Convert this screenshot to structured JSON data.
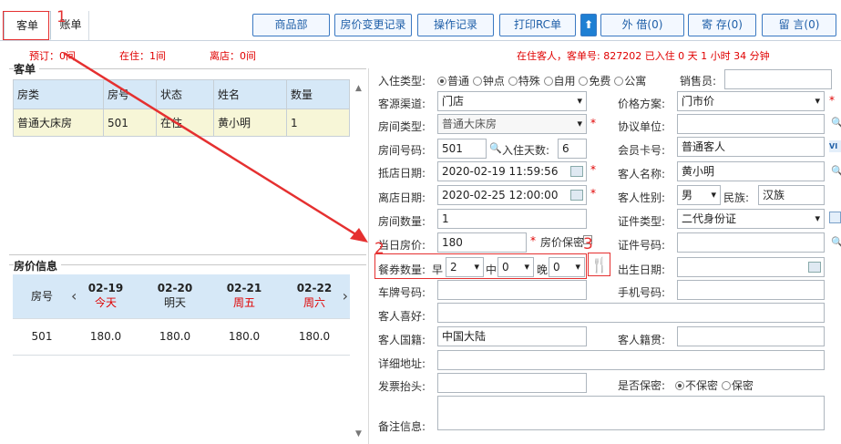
{
  "tabs": [
    "客单",
    "账单"
  ],
  "toolbar": {
    "goods": "商品部",
    "price_log": "房价变更记录",
    "op_log": "操作记录",
    "print_rc": "打印RC单",
    "lend": "外 借(0)",
    "deposit": "寄 存(0)",
    "message": "留 言(0)"
  },
  "summary": {
    "reserve": "预订：0间",
    "in_house": "在住：1间",
    "leave": "离店：0间",
    "status": "在住客人，客单号: 827202 已入住 0 天 1 小时 34 分钟"
  },
  "order": {
    "title": "客单",
    "headers": [
      "房类",
      "房号",
      "状态",
      "姓名",
      "数量"
    ],
    "rows": [
      [
        "普通大床房",
        "501",
        "在住",
        "黄小明",
        "1"
      ]
    ]
  },
  "price": {
    "title": "房价信息",
    "room_header": "房号",
    "dates": [
      {
        "date": "02-19",
        "day": "今天"
      },
      {
        "date": "02-20",
        "day": "明天"
      },
      {
        "date": "02-21",
        "day": "周五"
      },
      {
        "date": "02-22",
        "day": "周六"
      }
    ],
    "rows": [
      [
        "501",
        "180.0",
        "180.0",
        "180.0",
        "180.0"
      ]
    ]
  },
  "form": {
    "checkin_type_label": "入住类型:",
    "checkin_types": [
      "普通",
      "钟点",
      "特殊",
      "自用",
      "免费",
      "公寓"
    ],
    "sales_label": "销售员:",
    "channel_label": "客源渠道:",
    "channel": "门店",
    "price_plan_label": "价格方案:",
    "price_plan": "门市价",
    "room_type_label": "房间类型:",
    "room_type": "普通大床房",
    "agreement_label": "协议单位:",
    "room_no_label": "房间号码:",
    "room_no": "501",
    "days_label": "入住天数:",
    "days": "6",
    "member_label": "会员卡号:",
    "member": "普通客人",
    "arrive_label": "抵店日期:",
    "arrive": "2020-02-19 11:59:56",
    "name_label": "客人名称:",
    "name": "黄小明",
    "leave_label": "离店日期:",
    "leave": "2020-02-25 12:00:00",
    "gender_label": "客人性别:",
    "gender": "男",
    "ethnic_label": "民族:",
    "ethnic": "汉族",
    "rooms_label": "房间数量:",
    "rooms": "1",
    "id_type_label": "证件类型:",
    "id_type": "二代身份证",
    "day_price_label": "当日房价:",
    "day_price": "180",
    "price_secret_label": "房价保密",
    "id_no_label": "证件号码:",
    "meal_label": "餐券数量:",
    "breakfast_label": "早",
    "breakfast": "2",
    "lunch_label": "中",
    "lunch": "0",
    "dinner_label": "晚",
    "dinner": "0",
    "birth_label": "出生日期:",
    "plate_label": "车牌号码:",
    "phone_label": "手机号码:",
    "hobby_label": "客人喜好:",
    "nation_label": "客人国籍:",
    "nation": "中国大陆",
    "origin_label": "客人籍贯:",
    "address_label": "详细地址:",
    "invoice_label": "发票抬头:",
    "secret_label": "是否保密:",
    "secret_options": [
      "不保密",
      "保密"
    ],
    "remark_label": "备注信息:"
  },
  "markers": [
    "1",
    "2",
    "3"
  ],
  "colors": {
    "annotation": "#e53030",
    "header_bg": "#d6e8f7",
    "row_bg": "#f7f6d7",
    "accent": "#1f5fa8"
  }
}
